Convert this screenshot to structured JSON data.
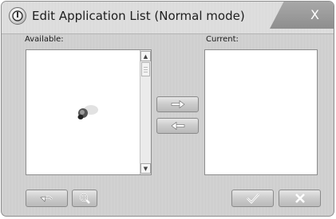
{
  "window": {
    "title": "Edit Application List (Normal mode)",
    "close_label": "X"
  },
  "available": {
    "label": "Available:"
  },
  "current": {
    "label": "Current:"
  },
  "transfer": {
    "add_icon": "arrow-right-icon",
    "remove_icon": "arrow-left-icon"
  },
  "footer": {
    "undo_icon": "undo-icon",
    "search_icon": "magnifier-icon",
    "ok_icon": "checkmark-icon",
    "cancel_icon": "x-icon"
  }
}
